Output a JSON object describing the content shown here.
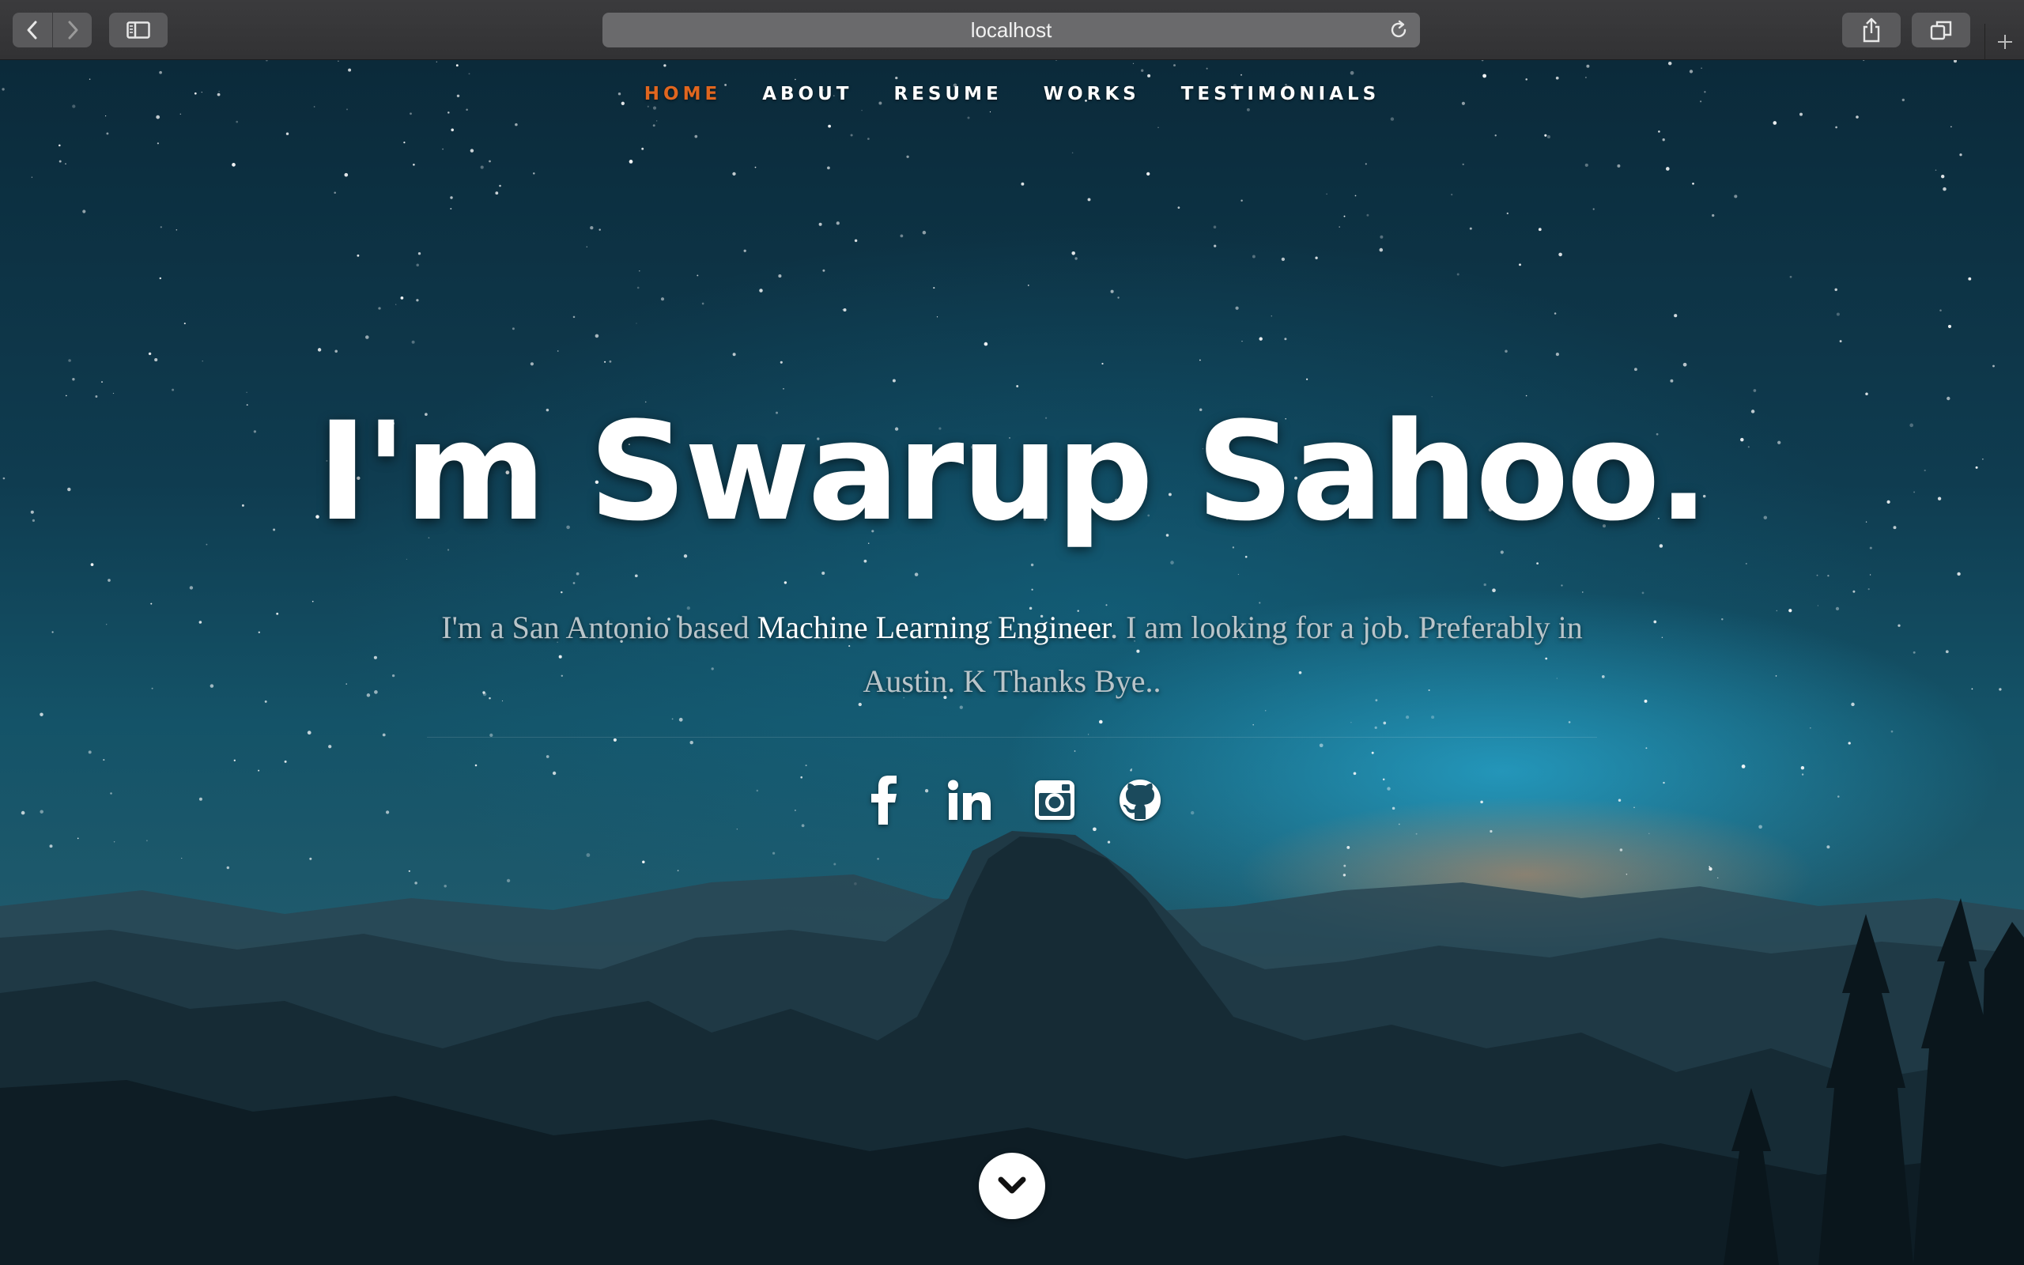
{
  "browser": {
    "url": "localhost"
  },
  "nav": {
    "items": [
      {
        "label": "HOME",
        "active": true
      },
      {
        "label": "ABOUT"
      },
      {
        "label": "RESUME"
      },
      {
        "label": "WORKS"
      },
      {
        "label": "TESTIMONIALS"
      }
    ]
  },
  "hero": {
    "headline": "I'm Swarup Sahoo.",
    "intro_before": "I'm a San Antonio based ",
    "intro_highlight": "Machine Learning Engineer",
    "intro_after": ". I am looking for a job. Preferably in Austin. K Thanks Bye..",
    "social": [
      {
        "icon": "facebook-icon"
      },
      {
        "icon": "linkedin-icon"
      },
      {
        "icon": "instagram-icon"
      },
      {
        "icon": "github-icon"
      }
    ],
    "scroll_icon": "chevron-down-icon"
  },
  "colors": {
    "accent": "#e0661f",
    "chrome_bg": "#3b3b3d",
    "sky_dark": "#0b2a3a",
    "sky_glow": "#28aad2"
  }
}
